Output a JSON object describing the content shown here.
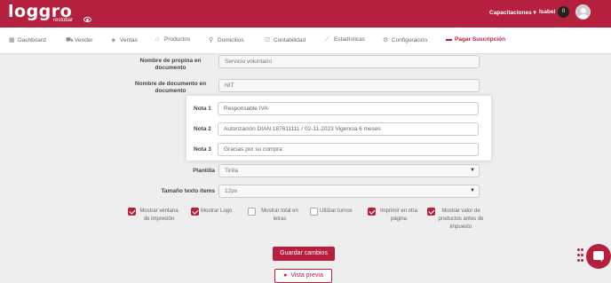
{
  "header": {
    "logo_text": "loggro",
    "logo_subtext": "restobar",
    "capacitaciones": "Capacitaciones ▾",
    "user_name": "Isabel",
    "notification_count": "0"
  },
  "nav": {
    "items": [
      {
        "label": "Dashboard",
        "icon": "dashboard-icon",
        "glyph": "▦"
      },
      {
        "label": "Vender",
        "icon": "cart-icon",
        "glyph": "⛟"
      },
      {
        "label": "Ventas",
        "icon": "tag-icon",
        "glyph": "◈"
      },
      {
        "label": "Productos",
        "icon": "box-icon",
        "glyph": "⌂"
      },
      {
        "label": "Domicilios",
        "icon": "scooter-icon",
        "glyph": "⚲"
      },
      {
        "label": "Contabilidad",
        "icon": "bank-icon",
        "glyph": "⛫"
      },
      {
        "label": "Estadísticas",
        "icon": "chart-icon",
        "glyph": "⟋"
      },
      {
        "label": "Configuración",
        "icon": "gear-icon",
        "glyph": "⚙"
      },
      {
        "label": "Pagar Suscripción",
        "icon": "card-icon",
        "glyph": "▬"
      }
    ]
  },
  "form": {
    "tip_doc_name_label": "Nombre de propina en documento",
    "tip_doc_name_value": "Servicio voluntario",
    "doc_name_label": "Nombre de documento en documento",
    "doc_name_value": "NIT",
    "template_label": "Plantilla",
    "template_value": "Tirilla",
    "text_size_label": "Tamaño texto ítems",
    "text_size_value": "12px"
  },
  "notes": {
    "note1_label": "Nota 1",
    "note1_value": "Responsable IVA",
    "note2_label": "Nota 2",
    "note2_value": "Autorización DIAN 187611111 / 02-11-2023 Vigencia 6 meses",
    "note3_label": "Nota 3",
    "note3_value": "Gracias por su compra"
  },
  "options": [
    {
      "label": "Mostrar ventana de impresión",
      "checked": true
    },
    {
      "label": "Mostrar Logo",
      "checked": true
    },
    {
      "label": "Mostrar total en letras",
      "checked": false
    },
    {
      "label": "Utilizar turnos",
      "checked": false
    },
    {
      "label": "Imprimir en otra página",
      "checked": true
    },
    {
      "label": "Mostrar valor de productos antes de impuesto",
      "checked": true
    }
  ],
  "actions": {
    "save_label": "Guardar cambios",
    "preview_label": "Vista previa"
  },
  "colors": {
    "brand": "#b4203d"
  }
}
